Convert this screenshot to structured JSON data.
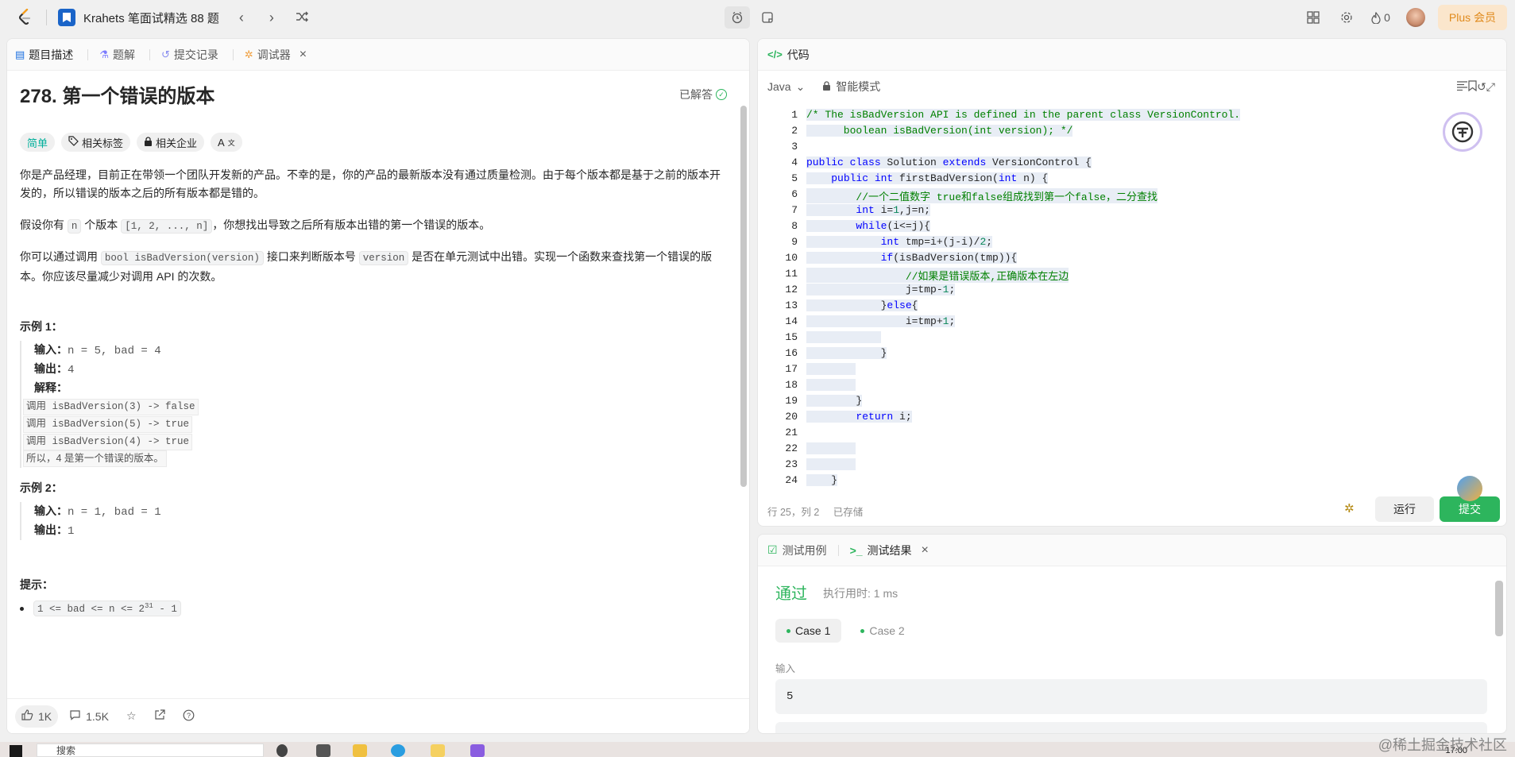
{
  "topnav": {
    "list_name": "Krahets 笔面试精选 88 题",
    "streak": "0",
    "plus_label": "Plus 会员"
  },
  "left": {
    "tabs": [
      {
        "label": "题目描述"
      },
      {
        "label": "题解"
      },
      {
        "label": "提交记录"
      },
      {
        "label": "调试器"
      }
    ],
    "title": "278. 第一个错误的版本",
    "solved": "已解答",
    "tags": {
      "difficulty": "简单",
      "topics": "相关标签",
      "companies": "相关企业",
      "translate": "A"
    },
    "desc": {
      "p1": "你是产品经理，目前正在带领一个团队开发新的产品。不幸的是，你的产品的最新版本没有通过质量检测。由于每个版本都是基于之前的版本开发的，所以错误的版本之后的所有版本都是错的。",
      "p2_a": "假设你有 ",
      "p2_n": "n",
      "p2_b": " 个版本 ",
      "p2_arr": "[1, 2, ..., n]",
      "p2_c": "，你想找出导致之后所有版本出错的第一个错误的版本。",
      "p3_a": "你可以通过调用 ",
      "p3_fn": "bool isBadVersion(version)",
      "p3_b": " 接口来判断版本号 ",
      "p3_v": "version",
      "p3_c": " 是否在单元测试中出错。实现一个函数来查找第一个错误的版本。你应该尽量减少对调用 API 的次数。"
    },
    "example1": {
      "title": "示例 1：",
      "input_label": "输入：",
      "input": "n = 5, bad = 4",
      "output_label": "输出：",
      "output": "4",
      "explain_label": "解释：",
      "explain": [
        "调用 isBadVersion(3) -> false",
        "调用 isBadVersion(5) -> true",
        "调用 isBadVersion(4) -> true",
        "所以，4 是第一个错误的版本。"
      ]
    },
    "example2": {
      "title": "示例 2：",
      "input_label": "输入：",
      "input": "n = 1, bad = 1",
      "output_label": "输出：",
      "output": "1"
    },
    "hints_title": "提示：",
    "hint_a": "1 <= bad <= n <= 2",
    "hint_sup": "31",
    "hint_b": " - 1",
    "footer": {
      "likes": "1K",
      "comments": "1.5K"
    }
  },
  "code": {
    "title": "代码",
    "lang": "Java",
    "mode": "智能模式",
    "status_pos": "行 25，列 2",
    "status_saved": "已存储",
    "run": "运行",
    "submit": "提交",
    "line_numbers": [
      "1",
      "2",
      "3",
      "4",
      "5",
      "6",
      "7",
      "8",
      "9",
      "10",
      "11",
      "12",
      "13",
      "14",
      "15",
      "16",
      "17",
      "18",
      "19",
      "20",
      "21",
      "22",
      "23",
      "24"
    ]
  },
  "test": {
    "tab1": "测试用例",
    "tab2": "测试结果",
    "passed": "通过",
    "runtime": "执行用时: 1 ms",
    "cases": [
      "Case 1",
      "Case 2"
    ],
    "input_label": "输入",
    "input_value": "5"
  },
  "taskbar": {
    "search": "搜索",
    "time": "17:00"
  },
  "watermark": "@稀土掘金技术社区"
}
